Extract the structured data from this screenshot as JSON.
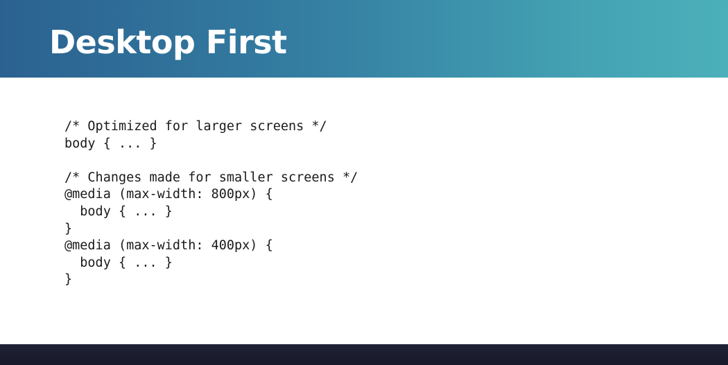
{
  "slide": {
    "title": "Desktop First",
    "code_lines": [
      "/* Optimized for larger screens */",
      "body { ... }",
      "",
      "/* Changes made for smaller screens */",
      "@media (max-width: 800px) {",
      "  body { ... }",
      "}",
      "@media (max-width: 400px) {",
      "  body { ... }",
      "}"
    ]
  },
  "colors": {
    "header_gradient_start": "#2b6190",
    "header_gradient_end": "#4bb0ba",
    "title_text": "#ffffff",
    "code_text": "#1a1a1a",
    "bottom_bar": "#1c1f31"
  }
}
